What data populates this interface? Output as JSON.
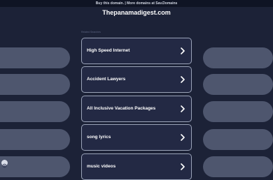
{
  "topbar": {
    "text": "Buy this domain. | More domains at Sav.Domains"
  },
  "header": {
    "domain": "Thepanamadigest.com"
  },
  "section": {
    "related_label": "Related Searches"
  },
  "links": [
    {
      "label": "High Speed Internet"
    },
    {
      "label": "Accident Lawyers"
    },
    {
      "label": "All Inclusive Vacation Packages"
    },
    {
      "label": "song lyrics"
    },
    {
      "label": "music videos"
    }
  ],
  "icons": {
    "chevron": "chevron-right-icon",
    "privacy": "privacy-icon"
  },
  "colors": {
    "background": "#1c2237",
    "card_border": "#9aa3b8",
    "side_pill": "#4e566e"
  }
}
